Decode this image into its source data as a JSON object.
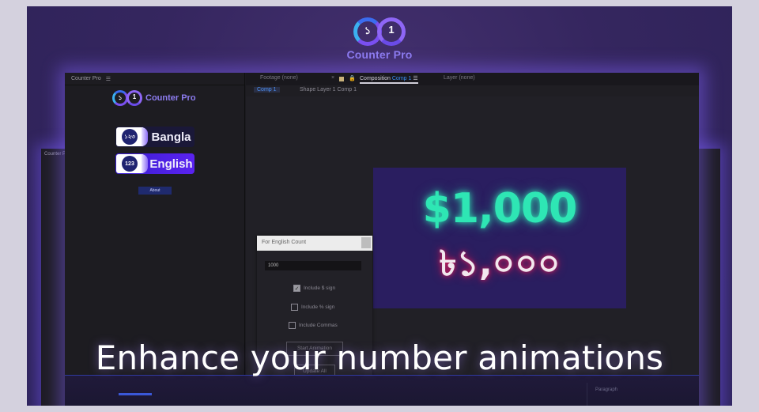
{
  "brand": {
    "name": "Counter Pro",
    "logo_digits": [
      "১",
      "1"
    ],
    "accent": "#8d7cf0"
  },
  "side_panel_left": {
    "label": "Counter P"
  },
  "panel": {
    "tab_label": "Counter Pro",
    "menu_icon": "hamburger-icon",
    "logo_name": "Counter Pro",
    "buttons": [
      {
        "label": "Bangla",
        "icon_text": "১২৩"
      },
      {
        "label": "English",
        "icon_text": "123"
      }
    ],
    "about_label": "About"
  },
  "viewer": {
    "tabs": {
      "footage": "Footage  (none)",
      "composition_prefix": "Composition",
      "composition_name": "Comp 1",
      "layer": "Layer  (none)"
    },
    "breadcrumbs": [
      "Comp 1",
      "Shape Layer 1 Comp 1"
    ]
  },
  "composition": {
    "english_value": "$1,000",
    "bangla_value": "৳১,০০০",
    "english_color": "#2ee6b4",
    "bangla_glow": "#d0215f"
  },
  "dialog": {
    "title": "For English Count",
    "value": "1000",
    "checkboxes": [
      {
        "label": "Include $ sign",
        "checked": true
      },
      {
        "label": "Include % sign",
        "checked": false
      },
      {
        "label": "Include Commas",
        "checked": false
      }
    ],
    "start_label": "Start Animation",
    "update_label": "Update All"
  },
  "timeline": {
    "paragraph_label": "Paragraph"
  },
  "caption": "Enhance your number animations"
}
